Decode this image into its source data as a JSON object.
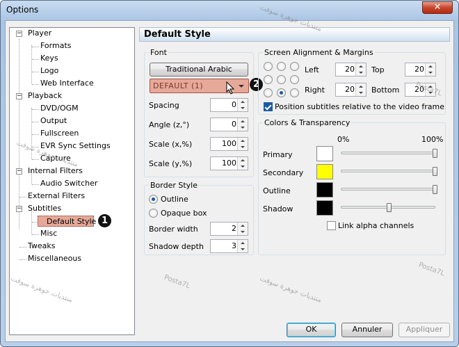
{
  "window": {
    "title": "Options",
    "close_glyph": "✕"
  },
  "tree": {
    "items": [
      {
        "label": "Player"
      },
      {
        "label": "Formats"
      },
      {
        "label": "Keys"
      },
      {
        "label": "Logo"
      },
      {
        "label": "Web Interface"
      },
      {
        "label": "Playback"
      },
      {
        "label": "DVD/OGM"
      },
      {
        "label": "Output"
      },
      {
        "label": "Fullscreen"
      },
      {
        "label": "EVR Sync Settings"
      },
      {
        "label": "Capture"
      },
      {
        "label": "Internal Filters"
      },
      {
        "label": "Audio Switcher"
      },
      {
        "label": "External Filters"
      },
      {
        "label": "Subtitles"
      },
      {
        "label": "Default Style"
      },
      {
        "label": "Misc"
      },
      {
        "label": "Tweaks"
      },
      {
        "label": "Miscellaneous"
      }
    ],
    "expander": "−",
    "badge1": "1"
  },
  "page": {
    "title": "Default Style"
  },
  "font": {
    "group_label": "Font",
    "font_button": "Traditional Arabic",
    "charset_value": "DEFAULT (1)",
    "badge2": "2",
    "spacing_label": "Spacing",
    "spacing_value": "0",
    "angle_label": "Angle (z,°)",
    "angle_value": "0",
    "scalex_label": "Scale (x,%)",
    "scalex_value": "100",
    "scaley_label": "Scale (y,%)",
    "scaley_value": "100"
  },
  "border": {
    "group_label": "Border Style",
    "outline_label": "Outline",
    "outline_selected": true,
    "opaque_label": "Opaque box",
    "width_label": "Border width",
    "width_value": "2",
    "shadow_label": "Shadow depth",
    "shadow_value": "3"
  },
  "alignment": {
    "group_label": "Screen Alignment & Margins",
    "selected_position": "bottom-center",
    "left_label": "Left",
    "left_value": "20",
    "top_label": "Top",
    "top_value": "20",
    "right_label": "Right",
    "right_value": "20",
    "bottom_label": "Bottom",
    "bottom_value": "20",
    "relative_label": "Position subtitles relative to the video frame",
    "relative_checked": true
  },
  "colors": {
    "group_label": "Colors & Transparency",
    "min_label": "0%",
    "max_label": "100%",
    "rows": [
      {
        "label": "Primary",
        "color": "#ffffff",
        "value_percent": 100
      },
      {
        "label": "Secondary",
        "color": "#ffff00",
        "value_percent": 100
      },
      {
        "label": "Outline",
        "color": "#000000",
        "value_percent": 100
      },
      {
        "label": "Shadow",
        "color": "#000000",
        "value_percent": 50
      }
    ],
    "link_label": "Link alpha channels",
    "link_checked": false
  },
  "buttons": {
    "ok": "OK",
    "cancel": "Annuler",
    "apply": "Appliquer"
  },
  "watermark": {
    "ar": "منتديات جوهرة سوفت",
    "latin": "Posta7L"
  }
}
